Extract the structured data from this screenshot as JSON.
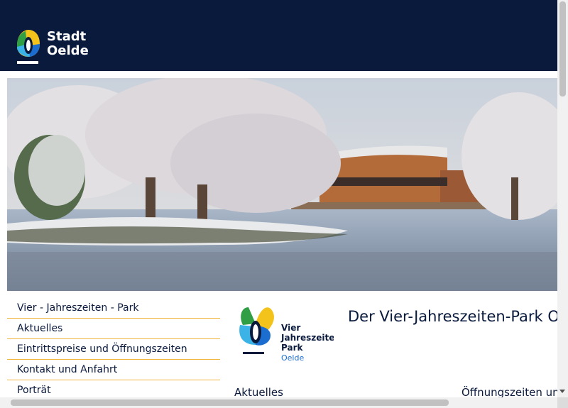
{
  "header": {
    "logo": {
      "line1": "Stadt",
      "line2": "Oelde"
    }
  },
  "hero": {
    "alt": "Verschneiter Vier-Jahreszeiten-Park mit See und Gebäude"
  },
  "sidenav": {
    "items": [
      {
        "label": "Vier - Jahreszeiten - Park"
      },
      {
        "label": "Aktuelles"
      },
      {
        "label": "Eintrittspreise und Öffnungszeiten"
      },
      {
        "label": "Kontakt und Anfahrt"
      },
      {
        "label": "Porträt"
      }
    ]
  },
  "content": {
    "park_logo": {
      "line1": "Vier",
      "line2": "Jahreszeiten",
      "line3": "Park",
      "line4": "Oelde"
    },
    "title": "Der Vier-Jahreszeiten-Park Oelde",
    "section_left": "Aktuelles",
    "section_right": "Öffnungszeiten und Eintrittspreise"
  },
  "colors": {
    "header_bg": "#0a1a3d",
    "nav_divider": "#f0b43a",
    "text": "#0a1a3d"
  }
}
